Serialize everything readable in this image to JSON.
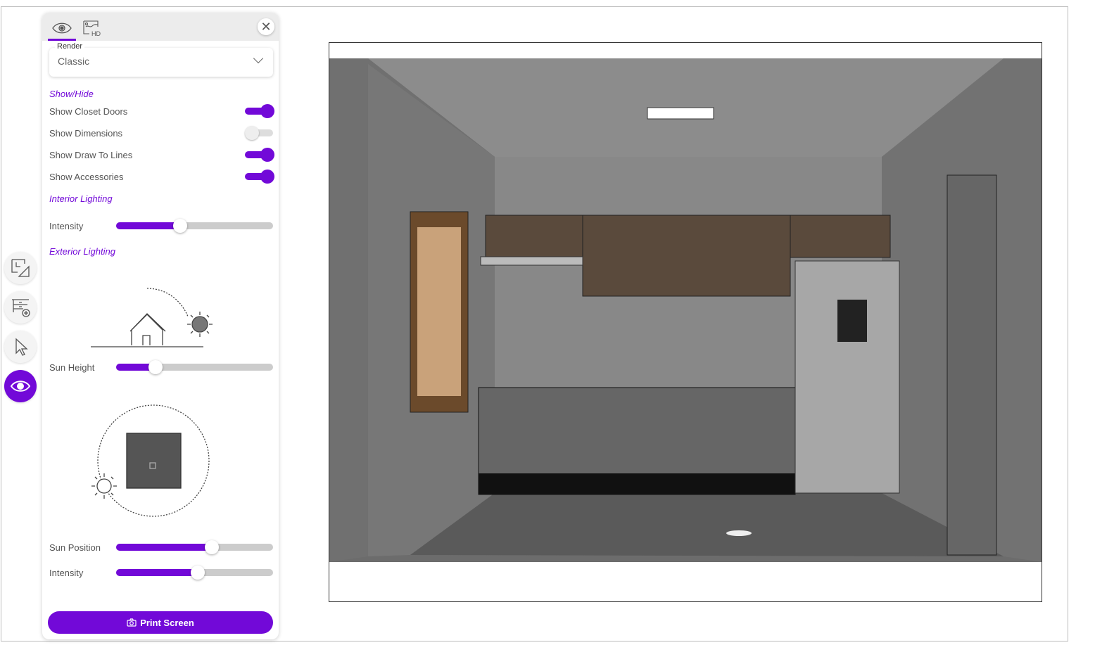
{
  "panel": {
    "tabs": [
      {
        "icon": "eye-icon",
        "active": true
      },
      {
        "icon": "hd-render-icon",
        "active": false
      }
    ],
    "render": {
      "label": "Render",
      "value": "Classic"
    },
    "show_hide": {
      "title": "Show/Hide",
      "items": [
        {
          "label": "Show Closet Doors",
          "on": true
        },
        {
          "label": "Show Dimensions",
          "on": false
        },
        {
          "label": "Show Draw To Lines",
          "on": true
        },
        {
          "label": "Show Accessories",
          "on": true
        }
      ]
    },
    "interior": {
      "title": "Interior Lighting",
      "intensity_label": "Intensity",
      "intensity": 0.41
    },
    "exterior": {
      "title": "Exterior Lighting",
      "sun_height_label": "Sun Height",
      "sun_height": 0.25,
      "sun_position_label": "Sun Position",
      "sun_position": 0.61,
      "intensity_label": "Intensity",
      "intensity": 0.52
    },
    "print_label": "Print Screen"
  },
  "sidebar": [
    {
      "icon": "floorplan-icon"
    },
    {
      "icon": "add-furniture-icon"
    },
    {
      "icon": "pointer-icon"
    },
    {
      "icon": "eye-icon",
      "active": true
    }
  ],
  "colors": {
    "accent": "#7209d8"
  }
}
